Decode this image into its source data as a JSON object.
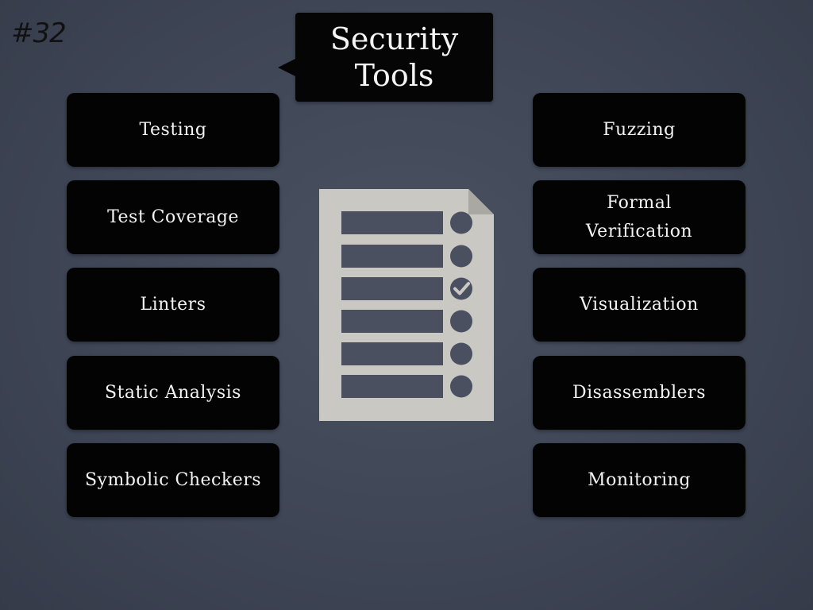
{
  "slide": {
    "number": "#32",
    "title": "Security Tools"
  },
  "left_column": [
    {
      "label": "Testing"
    },
    {
      "label": "Test Coverage"
    },
    {
      "label": "Linters"
    },
    {
      "label": "Static Analysis"
    },
    {
      "label": "Symbolic Checkers"
    }
  ],
  "right_column": [
    {
      "label": "Fuzzing"
    },
    {
      "label": "Formal Verification"
    },
    {
      "label": "Visualization"
    },
    {
      "label": "Disassemblers"
    },
    {
      "label": "Monitoring"
    }
  ],
  "center_graphic": {
    "icon": "checklist-form-icon",
    "rows": 6,
    "checked_row": 3
  },
  "colors": {
    "background": "#3f4656",
    "box": "#030303",
    "text": "#f3f3f3",
    "icon": "#c9c8c3"
  }
}
